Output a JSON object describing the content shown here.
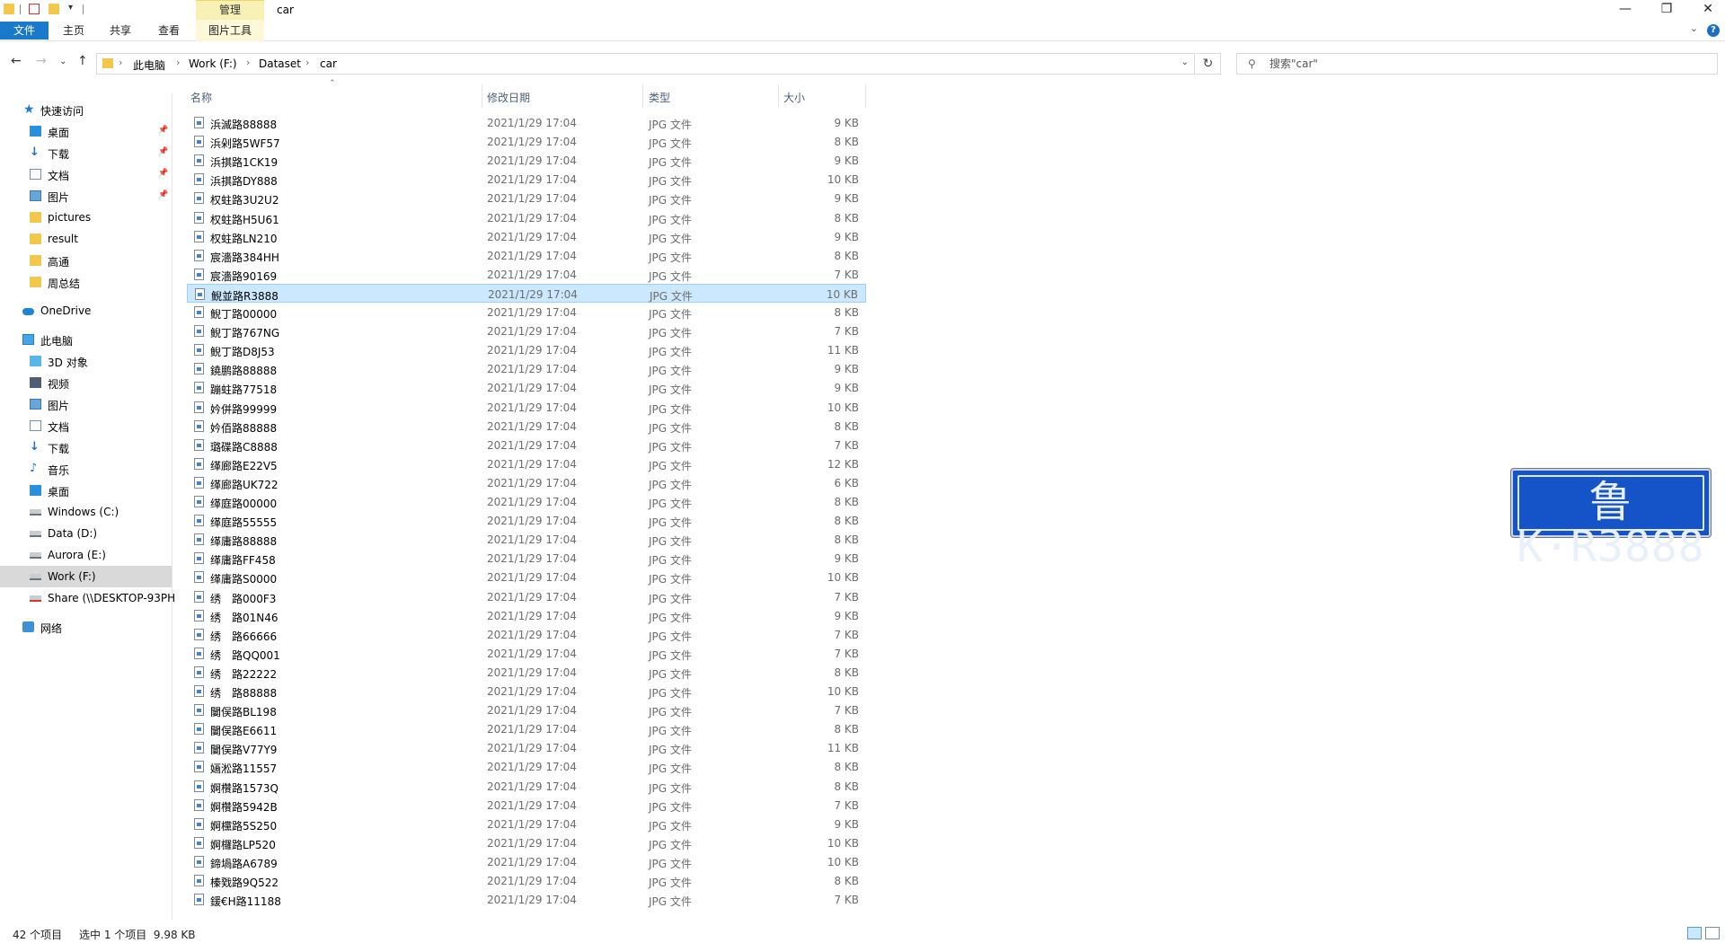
{
  "window": {
    "title": "car",
    "context_tab": "管理",
    "minimize": "—",
    "maximize": "❐",
    "close": "✕"
  },
  "ribbon": {
    "tabs": [
      "文件",
      "主页",
      "共享",
      "查看"
    ],
    "context_tab": "图片工具",
    "help": "?"
  },
  "address": {
    "breadcrumbs": [
      "此电脑",
      "Work (F:)",
      "Dataset",
      "car"
    ],
    "search_placeholder": "搜索\"car\""
  },
  "sidebar": {
    "quick_access": "快速访问",
    "quick_items": [
      {
        "label": "桌面",
        "icon": "desktop-icon",
        "pinned": true
      },
      {
        "label": "下载",
        "icon": "download-icon",
        "pinned": true
      },
      {
        "label": "文档",
        "icon": "document-icon",
        "pinned": true
      },
      {
        "label": "图片",
        "icon": "pictures-icon",
        "pinned": true
      },
      {
        "label": "pictures",
        "icon": "folder-icon",
        "pinned": false
      },
      {
        "label": "result",
        "icon": "folder-icon",
        "pinned": false
      },
      {
        "label": "高通",
        "icon": "folder-icon",
        "pinned": false
      },
      {
        "label": "周总结",
        "icon": "folder-icon",
        "pinned": false
      }
    ],
    "onedrive": "OneDrive",
    "this_pc": "此电脑",
    "pc_items": [
      {
        "label": "3D 对象",
        "icon": "3d-objects-icon"
      },
      {
        "label": "视频",
        "icon": "video-icon"
      },
      {
        "label": "图片",
        "icon": "pictures-icon"
      },
      {
        "label": "文档",
        "icon": "document-icon"
      },
      {
        "label": "下载",
        "icon": "download-icon"
      },
      {
        "label": "音乐",
        "icon": "music-icon"
      },
      {
        "label": "桌面",
        "icon": "desktop-icon"
      },
      {
        "label": "Windows (C:)",
        "icon": "drive-icon"
      },
      {
        "label": "Data (D:)",
        "icon": "drive-icon"
      },
      {
        "label": "Aurora (E:)",
        "icon": "drive-icon"
      },
      {
        "label": "Work (F:)",
        "icon": "drive-icon",
        "selected": true
      },
      {
        "label": "Share (\\\\DESKTOP-93PH",
        "icon": "network-drive-icon"
      }
    ],
    "network": "网络"
  },
  "columns": {
    "name": "名称",
    "date": "修改日期",
    "type": "类型",
    "size": "大小"
  },
  "files": [
    {
      "name": "浜滅路88888",
      "date": "2021/1/29 17:04",
      "type": "JPG 文件",
      "size": "9 KB"
    },
    {
      "name": "浜剁路5WF57",
      "date": "2021/1/29 17:04",
      "type": "JPG 文件",
      "size": "8 KB"
    },
    {
      "name": "浜掑路1CK19",
      "date": "2021/1/29 17:04",
      "type": "JPG 文件",
      "size": "9 KB"
    },
    {
      "name": "浜掑路DY888",
      "date": "2021/1/29 17:04",
      "type": "JPG 文件",
      "size": "10 KB"
    },
    {
      "name": "权蛀路3U2U2",
      "date": "2021/1/29 17:04",
      "type": "JPG 文件",
      "size": "9 KB"
    },
    {
      "name": "权蛀路H5U61",
      "date": "2021/1/29 17:04",
      "type": "JPG 文件",
      "size": "8 KB"
    },
    {
      "name": "权蛀路LN210",
      "date": "2021/1/29 17:04",
      "type": "JPG 文件",
      "size": "9 KB"
    },
    {
      "name": "宸濇路384HH",
      "date": "2021/1/29 17:04",
      "type": "JPG 文件",
      "size": "8 KB"
    },
    {
      "name": "宸濇路90169",
      "date": "2021/1/29 17:04",
      "type": "JPG 文件",
      "size": "7 KB"
    },
    {
      "name": "鲵並路R3888",
      "date": "2021/1/29 17:04",
      "type": "JPG 文件",
      "size": "10 KB",
      "selected": true
    },
    {
      "name": "鲵丁路00000",
      "date": "2021/1/29 17:04",
      "type": "JPG 文件",
      "size": "8 KB"
    },
    {
      "name": "鲵丁路767NG",
      "date": "2021/1/29 17:04",
      "type": "JPG 文件",
      "size": "7 KB"
    },
    {
      "name": "鲵丁路D8J53",
      "date": "2021/1/29 17:04",
      "type": "JPG 文件",
      "size": "11 KB"
    },
    {
      "name": "鐃鹏路88888",
      "date": "2021/1/29 17:04",
      "type": "JPG 文件",
      "size": "9 KB"
    },
    {
      "name": "蹦蛀路77518",
      "date": "2021/1/29 17:04",
      "type": "JPG 文件",
      "size": "9 KB"
    },
    {
      "name": "妗併路99999",
      "date": "2021/1/29 17:04",
      "type": "JPG 文件",
      "size": "10 KB"
    },
    {
      "name": "妗佰路88888",
      "date": "2021/1/29 17:04",
      "type": "JPG 文件",
      "size": "8 KB"
    },
    {
      "name": "璐碟路C8888",
      "date": "2021/1/29 17:04",
      "type": "JPG 文件",
      "size": "7 KB"
    },
    {
      "name": "缂廊路E22V5",
      "date": "2021/1/29 17:04",
      "type": "JPG 文件",
      "size": "12 KB"
    },
    {
      "name": "缂廊路UK722",
      "date": "2021/1/29 17:04",
      "type": "JPG 文件",
      "size": "6 KB"
    },
    {
      "name": "缂庭路00000",
      "date": "2021/1/29 17:04",
      "type": "JPG 文件",
      "size": "8 KB"
    },
    {
      "name": "缂庭路55555",
      "date": "2021/1/29 17:04",
      "type": "JPG 文件",
      "size": "8 KB"
    },
    {
      "name": "缂庸路88888",
      "date": "2021/1/29 17:04",
      "type": "JPG 文件",
      "size": "8 KB"
    },
    {
      "name": "缂庸路FF458",
      "date": "2021/1/29 17:04",
      "type": "JPG 文件",
      "size": "9 KB"
    },
    {
      "name": "缂庸路S0000",
      "date": "2021/1/29 17:04",
      "type": "JPG 文件",
      "size": "10 KB"
    },
    {
      "name": "绣　路000F3",
      "date": "2021/1/29 17:04",
      "type": "JPG 文件",
      "size": "7 KB"
    },
    {
      "name": "绣　路01N46",
      "date": "2021/1/29 17:04",
      "type": "JPG 文件",
      "size": "9 KB"
    },
    {
      "name": "绣　路66666",
      "date": "2021/1/29 17:04",
      "type": "JPG 文件",
      "size": "7 KB"
    },
    {
      "name": "绣　路QQ001",
      "date": "2021/1/29 17:04",
      "type": "JPG 文件",
      "size": "7 KB"
    },
    {
      "name": "绣　路22222",
      "date": "2021/1/29 17:04",
      "type": "JPG 文件",
      "size": "8 KB"
    },
    {
      "name": "绣　路88888",
      "date": "2021/1/29 17:04",
      "type": "JPG 文件",
      "size": "10 KB"
    },
    {
      "name": "闄俣路BL198",
      "date": "2021/1/29 17:04",
      "type": "JPG 文件",
      "size": "7 KB"
    },
    {
      "name": "闄俣路E6611",
      "date": "2021/1/29 17:04",
      "type": "JPG 文件",
      "size": "8 KB"
    },
    {
      "name": "闄俣路V77Y9",
      "date": "2021/1/29 17:04",
      "type": "JPG 文件",
      "size": "11 KB"
    },
    {
      "name": "婳淞路11557",
      "date": "2021/1/29 17:04",
      "type": "JPG 文件",
      "size": "8 KB"
    },
    {
      "name": "婀欑路1573Q",
      "date": "2021/1/29 17:04",
      "type": "JPG 文件",
      "size": "8 KB"
    },
    {
      "name": "婀欑路5942B",
      "date": "2021/1/29 17:04",
      "type": "JPG 文件",
      "size": "7 KB"
    },
    {
      "name": "婀欓路5S250",
      "date": "2021/1/29 17:04",
      "type": "JPG 文件",
      "size": "9 KB"
    },
    {
      "name": "婀欏路LP520",
      "date": "2021/1/29 17:04",
      "type": "JPG 文件",
      "size": "10 KB"
    },
    {
      "name": "鍗堝路A6789",
      "date": "2021/1/29 17:04",
      "type": "JPG 文件",
      "size": "10 KB"
    },
    {
      "name": "榛戣路9Q522",
      "date": "2021/1/29 17:04",
      "type": "JPG 文件",
      "size": "8 KB"
    },
    {
      "name": "鍰€H路11188",
      "date": "2021/1/29 17:04",
      "type": "JPG 文件",
      "size": "7 KB"
    }
  ],
  "preview": {
    "plate_text": "鲁K·R3888",
    "plate_color": "#1553c9"
  },
  "status": {
    "item_count": "42 个项目",
    "selection": "选中 1 个项目  9.98 KB"
  }
}
